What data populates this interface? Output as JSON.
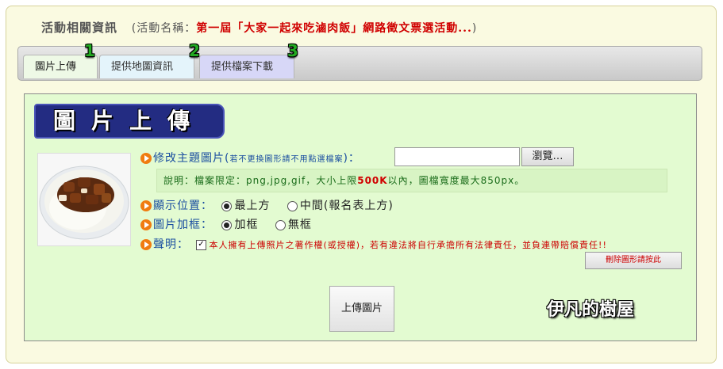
{
  "header": {
    "title": "活動相關資訊",
    "activity_label": "(活動名稱：",
    "activity_name": "第一屆「大家一起來吃滷肉飯」網路徵文票選活動...",
    "activity_close": ")"
  },
  "tabs": [
    {
      "label": "圖片上傳",
      "number": "1"
    },
    {
      "label": "提供地圖資訊",
      "number": "2"
    },
    {
      "label": "提供檔案下載",
      "number": "3"
    }
  ],
  "panel": {
    "banner": "圖片上傳",
    "image_alt": "滷肉飯",
    "change_image_label": "修改主題圖片(",
    "change_image_hint": "若不更換圖形請不用點選檔案",
    "change_image_close": ")：",
    "file_value": "",
    "browse_label": "瀏覽…",
    "note_prefix": "說明：檔案限定：png,jpg,gif，大小上限",
    "note_limit": "500K",
    "note_suffix": "以內，圖檔寬度最大850px。",
    "position_label": "顯示位置：",
    "position_options": [
      "最上方",
      "中間(報名表上方)"
    ],
    "position_selected": "最上方",
    "frame_label": "圖片加框：",
    "frame_options": [
      "加框",
      "無框"
    ],
    "frame_selected": "加框",
    "declare_label": "聲明：",
    "declare_checked": true,
    "declare_text": "本人擁有上傳照片之著作權(或授權)，若有違法將自行承擔所有法律責任，並負連帶賠償責任!!",
    "delete_button": "刪除圖形請按此",
    "upload_button": "上傳圖片",
    "watermark": "伊凡的樹屋"
  },
  "colors": {
    "panel_bg": "#e3fbd1",
    "banner_bg": "#232c82",
    "accent_red": "#d00000",
    "link_blue": "#1a4ea0"
  }
}
